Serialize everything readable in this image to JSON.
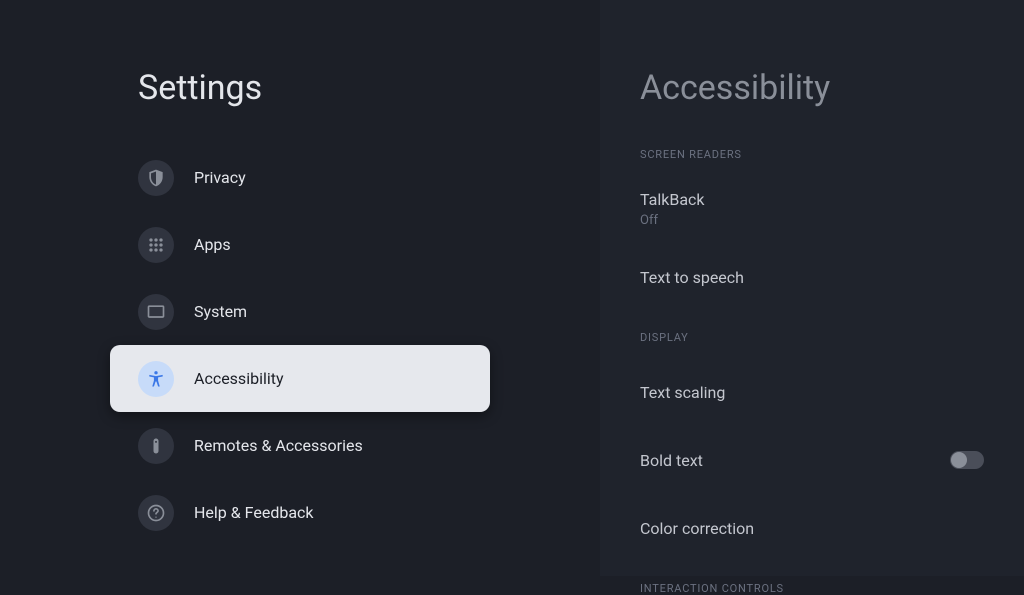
{
  "sidebar": {
    "title": "Settings",
    "items": [
      {
        "label": "Privacy",
        "icon": "shield"
      },
      {
        "label": "Apps",
        "icon": "grid"
      },
      {
        "label": "System",
        "icon": "monitor"
      },
      {
        "label": "Accessibility",
        "icon": "accessibility",
        "selected": true
      },
      {
        "label": "Remotes & Accessories",
        "icon": "remote"
      },
      {
        "label": "Help & Feedback",
        "icon": "help"
      }
    ]
  },
  "detail": {
    "title": "Accessibility",
    "sections": [
      {
        "header": "SCREEN READERS",
        "items": [
          {
            "label": "TalkBack",
            "sub": "Off"
          },
          {
            "label": "Text to speech"
          }
        ]
      },
      {
        "header": "DISPLAY",
        "items": [
          {
            "label": "Text scaling"
          },
          {
            "label": "Bold text",
            "toggle": false
          },
          {
            "label": "Color correction"
          }
        ]
      },
      {
        "header": "INTERACTION CONTROLS",
        "items": []
      }
    ]
  }
}
